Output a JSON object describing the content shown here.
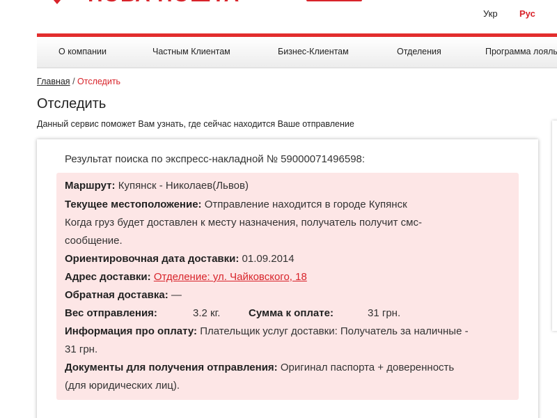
{
  "header": {
    "logo_text": "НОВА ПОШТА",
    "languages": {
      "ukr": "Укр",
      "rus": "Рус"
    },
    "brand_color": "#d8232a"
  },
  "nav": {
    "items": [
      "О компании",
      "Частным Клиентам",
      "Бизнес-Клиентам",
      "Отделения",
      "Программа лояльности"
    ]
  },
  "breadcrumb": {
    "home": "Главная",
    "separator": "/",
    "current": "Отследить"
  },
  "page": {
    "title": "Отследить",
    "description": "Данный сервис поможет Вам узнать, где сейчас находится Ваше отправление"
  },
  "result": {
    "title": "Результат поиска по экспресс-накладной № 59000071496598:",
    "route_label": "Маршрут:",
    "route_value": "Купянск - Николаев(Львов)",
    "location_label": "Текущее местоположение:",
    "location_value": "Отправление находится в городе Купянск",
    "sms_line1": "Когда груз будет доставлен к месту назначения, получатель получит смс-",
    "sms_line2": "сообщение.",
    "date_label": "Ориентировочная дата доставки:",
    "date_value": "01.09.2014",
    "address_label": "Адрес доставки:",
    "address_value": "Отделение: ул. Чайковского, 18",
    "return_label": "Обратная доставка:",
    "return_value": "—",
    "weight_label": "Вес отправления:",
    "weight_value": "3.2 кг.",
    "sum_label": "Сумма к оплате:",
    "sum_value": "31 грн.",
    "payment_label": "Информация про оплату:",
    "payment_value_line1": "Плательщик услуг доставки: Получатель за наличные -",
    "payment_value_line2": "31 грн.",
    "docs_label": "Документы для получения отправления:",
    "docs_value_line1": "Оригинал паспорта + доверенность",
    "docs_value_line2": "(для юридических лиц)."
  }
}
